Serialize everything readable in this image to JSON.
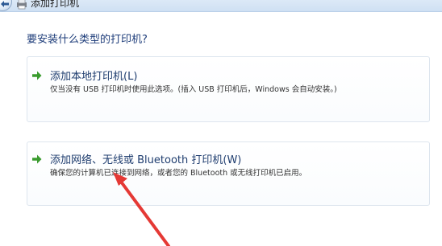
{
  "window": {
    "title": "添加打印机",
    "icons": [
      "back-arrow-icon",
      "printer-icon"
    ]
  },
  "main": {
    "question": "要安装什么类型的打印机?",
    "options": [
      {
        "icon": "green-arrow-icon",
        "title": "添加本地打印机(L)",
        "description": "仅当没有 USB 打印机时使用此选项。(插入 USB 打印机后，Windows 会自动安装。)"
      },
      {
        "icon": "green-arrow-icon",
        "title": "添加网络、无线或 Bluetooth 打印机(W)",
        "description": "确保您的计算机已连接到网络，或者您的 Bluetooth 或无线打印机已启用。"
      }
    ]
  },
  "annotation": {
    "color": "#e53935",
    "icon": "red-pointer-arrow-icon"
  }
}
